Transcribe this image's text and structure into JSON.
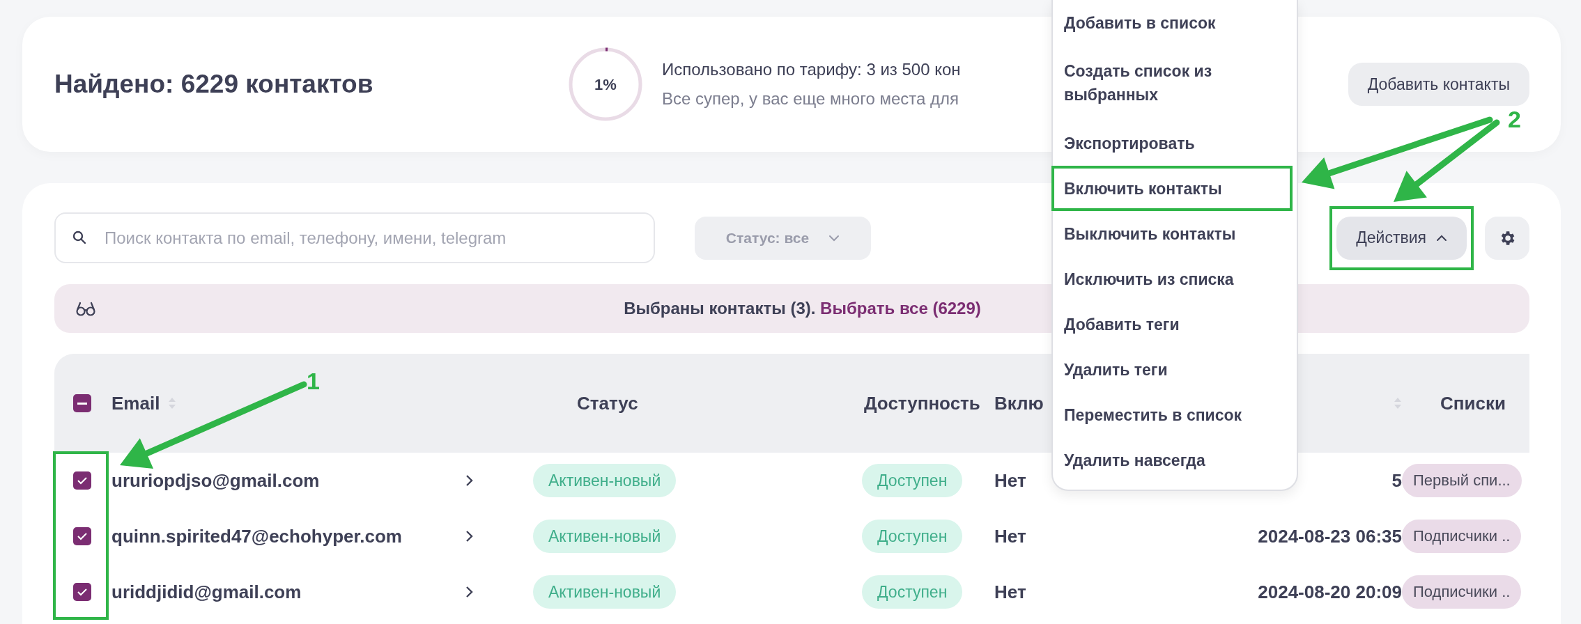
{
  "header": {
    "title": "Найдено: 6229 контактов",
    "usage": {
      "level": 0.01,
      "percent": "1%",
      "line1": "Использовано по тарифу: 3 из 500 кон",
      "line2": "Все супер, у вас еще много места для"
    },
    "add_button": "Добавить контакты"
  },
  "toolbar": {
    "search": {
      "placeholder": "Поиск контакта по email, телефону, имени, telegram"
    },
    "status_filter": "Статус: все",
    "actions": {
      "label": "Действия",
      "expanded": true,
      "outlined": true
    }
  },
  "selection": {
    "text": "Выбраны контакты (3).",
    "link": "Выбрать все (6229)"
  },
  "table": {
    "select_all": {
      "indeterminate": true
    },
    "columns": [
      {
        "label": "Email",
        "sortable": true
      },
      {
        "label": "Статус",
        "sortable": false
      },
      {
        "label": "Доступность",
        "sortable": false
      },
      {
        "label": "Вклю",
        "sortable": false
      },
      {
        "sortable": true
      },
      {
        "label": "Списки",
        "sortable": false
      }
    ],
    "rows": [
      {
        "checked": true,
        "email": "ururiopdjso@gmail.com",
        "status": "Активен-новый",
        "availability": "Доступен",
        "enabled": "Нет",
        "date": "5",
        "list": "Первый спи..."
      },
      {
        "checked": true,
        "email": "quinn.spirited47@echohyper.com",
        "status": "Активен-новый",
        "availability": "Доступен",
        "enabled": "Нет",
        "date": "2024-08-23 06:35",
        "list": "Подписчики .."
      },
      {
        "checked": true,
        "email": "uriddjidid@gmail.com",
        "status": "Активен-новый",
        "availability": "Доступен",
        "enabled": "Нет",
        "date": "2024-08-20 20:09",
        "list": "Подписчики .."
      }
    ]
  },
  "menu": {
    "items": [
      {
        "label": "Добавить в список",
        "outlined": false
      },
      {
        "label": "Создать список из выбранных",
        "outlined": false
      },
      {
        "label": "Экспортировать",
        "outlined": false
      },
      {
        "label": "Включить контакты",
        "outlined": true
      },
      {
        "label": "Выключить контакты",
        "outlined": false
      },
      {
        "label": "Исключить из списка",
        "outlined": false
      },
      {
        "label": "Добавить теги",
        "outlined": false
      },
      {
        "label": "Удалить теги",
        "outlined": false
      },
      {
        "label": "Переместить в список",
        "outlined": false
      },
      {
        "label": "Удалить навсегда",
        "outlined": false
      }
    ]
  },
  "annotations": [
    {
      "label": "1"
    },
    {
      "label": "2"
    }
  ]
}
